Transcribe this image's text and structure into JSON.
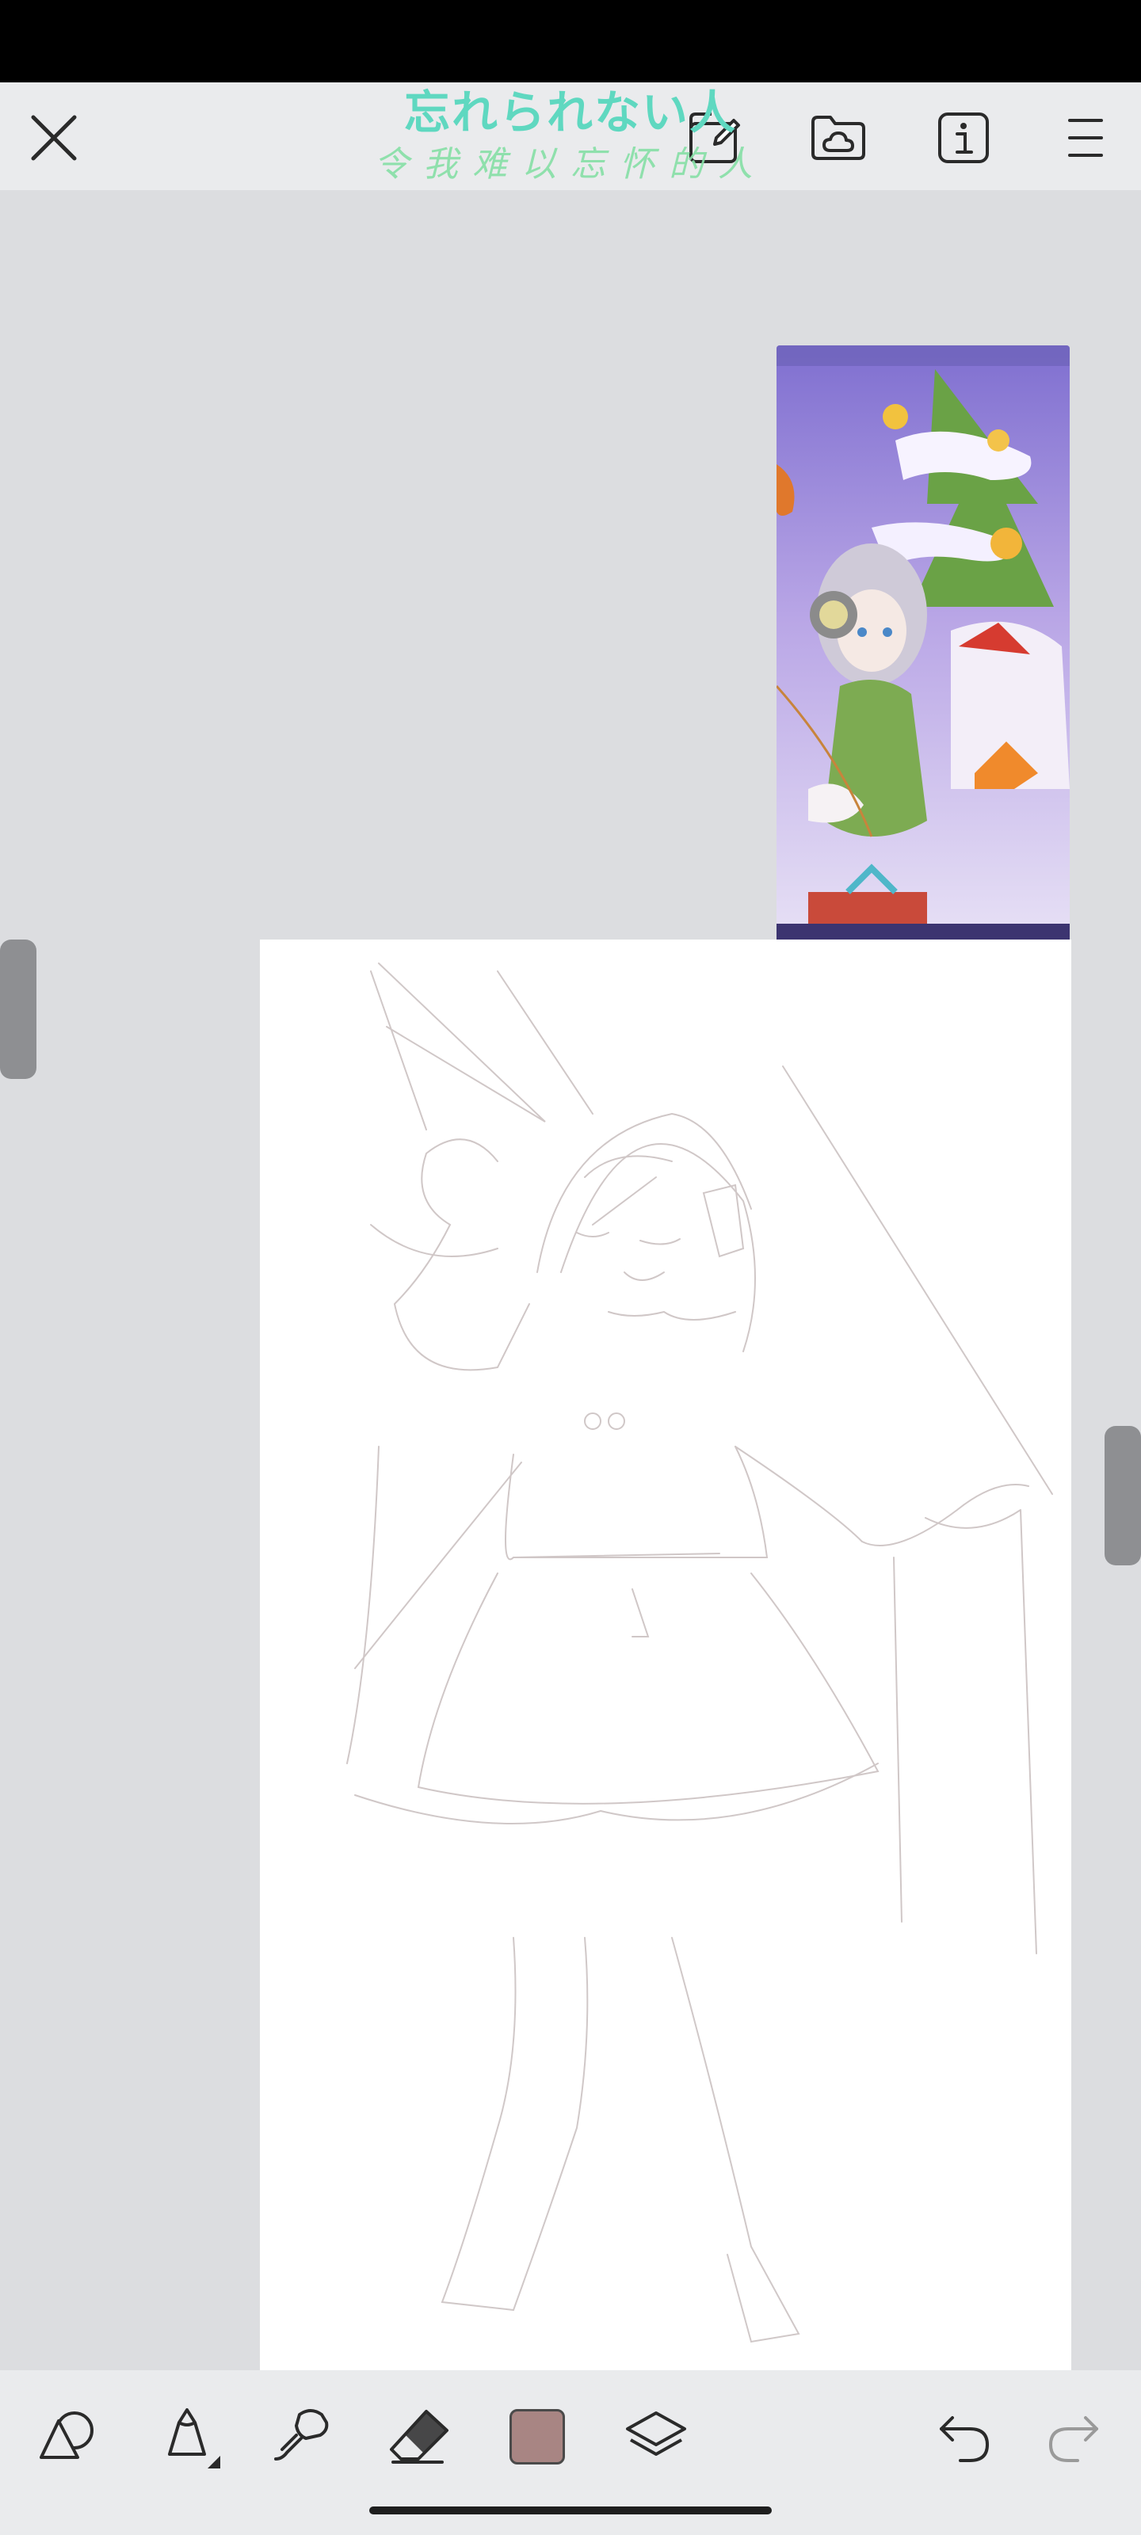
{
  "header": {
    "watermark_line1": "忘れられない人",
    "watermark_line2": "令我难以忘怀的人",
    "icons": [
      "close-icon",
      "canvas-resize-icon",
      "cloud-folder-icon",
      "info-icon",
      "menu-icon"
    ]
  },
  "toolbar": {
    "tools": [
      "shapes-tool",
      "pen-tool",
      "smudge-tool",
      "eraser-tool",
      "color-picker",
      "layers-tool"
    ],
    "current_color": "#a88583",
    "history": [
      "undo",
      "redo"
    ]
  },
  "colors": {
    "status_bar": "#000000",
    "toolbar_bg": "#eaebed",
    "canvas_bg": "#dcdde0",
    "paper": "#ffffff",
    "icon": "#2a2a2a",
    "icon_disabled": "#9a9a9a"
  }
}
